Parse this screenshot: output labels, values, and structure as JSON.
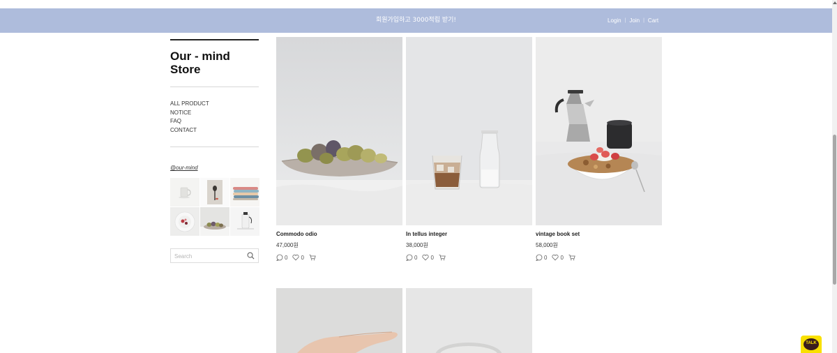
{
  "top_bar": {
    "promo_text": "회원가입하고 3000적립 받기!",
    "login": "Login",
    "join": "Join",
    "cart": "Cart",
    "separator": "|"
  },
  "sidebar": {
    "store_title": "Our - mind Store",
    "nav": [
      {
        "label": "ALL PRODUCT"
      },
      {
        "label": "NOTICE"
      },
      {
        "label": "FAQ"
      },
      {
        "label": "CONTACT"
      }
    ],
    "instagram_handle": "@our-mind",
    "search": {
      "placeholder": "Search",
      "value": ""
    }
  },
  "products": [
    {
      "name": "Commodo odio",
      "price": "47,000원",
      "comments": "0",
      "likes": "0"
    },
    {
      "name": "In tellus integer",
      "price": "38,000원",
      "comments": "0",
      "likes": "0"
    },
    {
      "name": "vintage book set",
      "price": "58,000원",
      "comments": "0",
      "likes": "0"
    }
  ],
  "talk_button": {
    "label": "TALK"
  },
  "colors": {
    "top_bar": "#aebcdc",
    "talk": "#f9e000"
  }
}
